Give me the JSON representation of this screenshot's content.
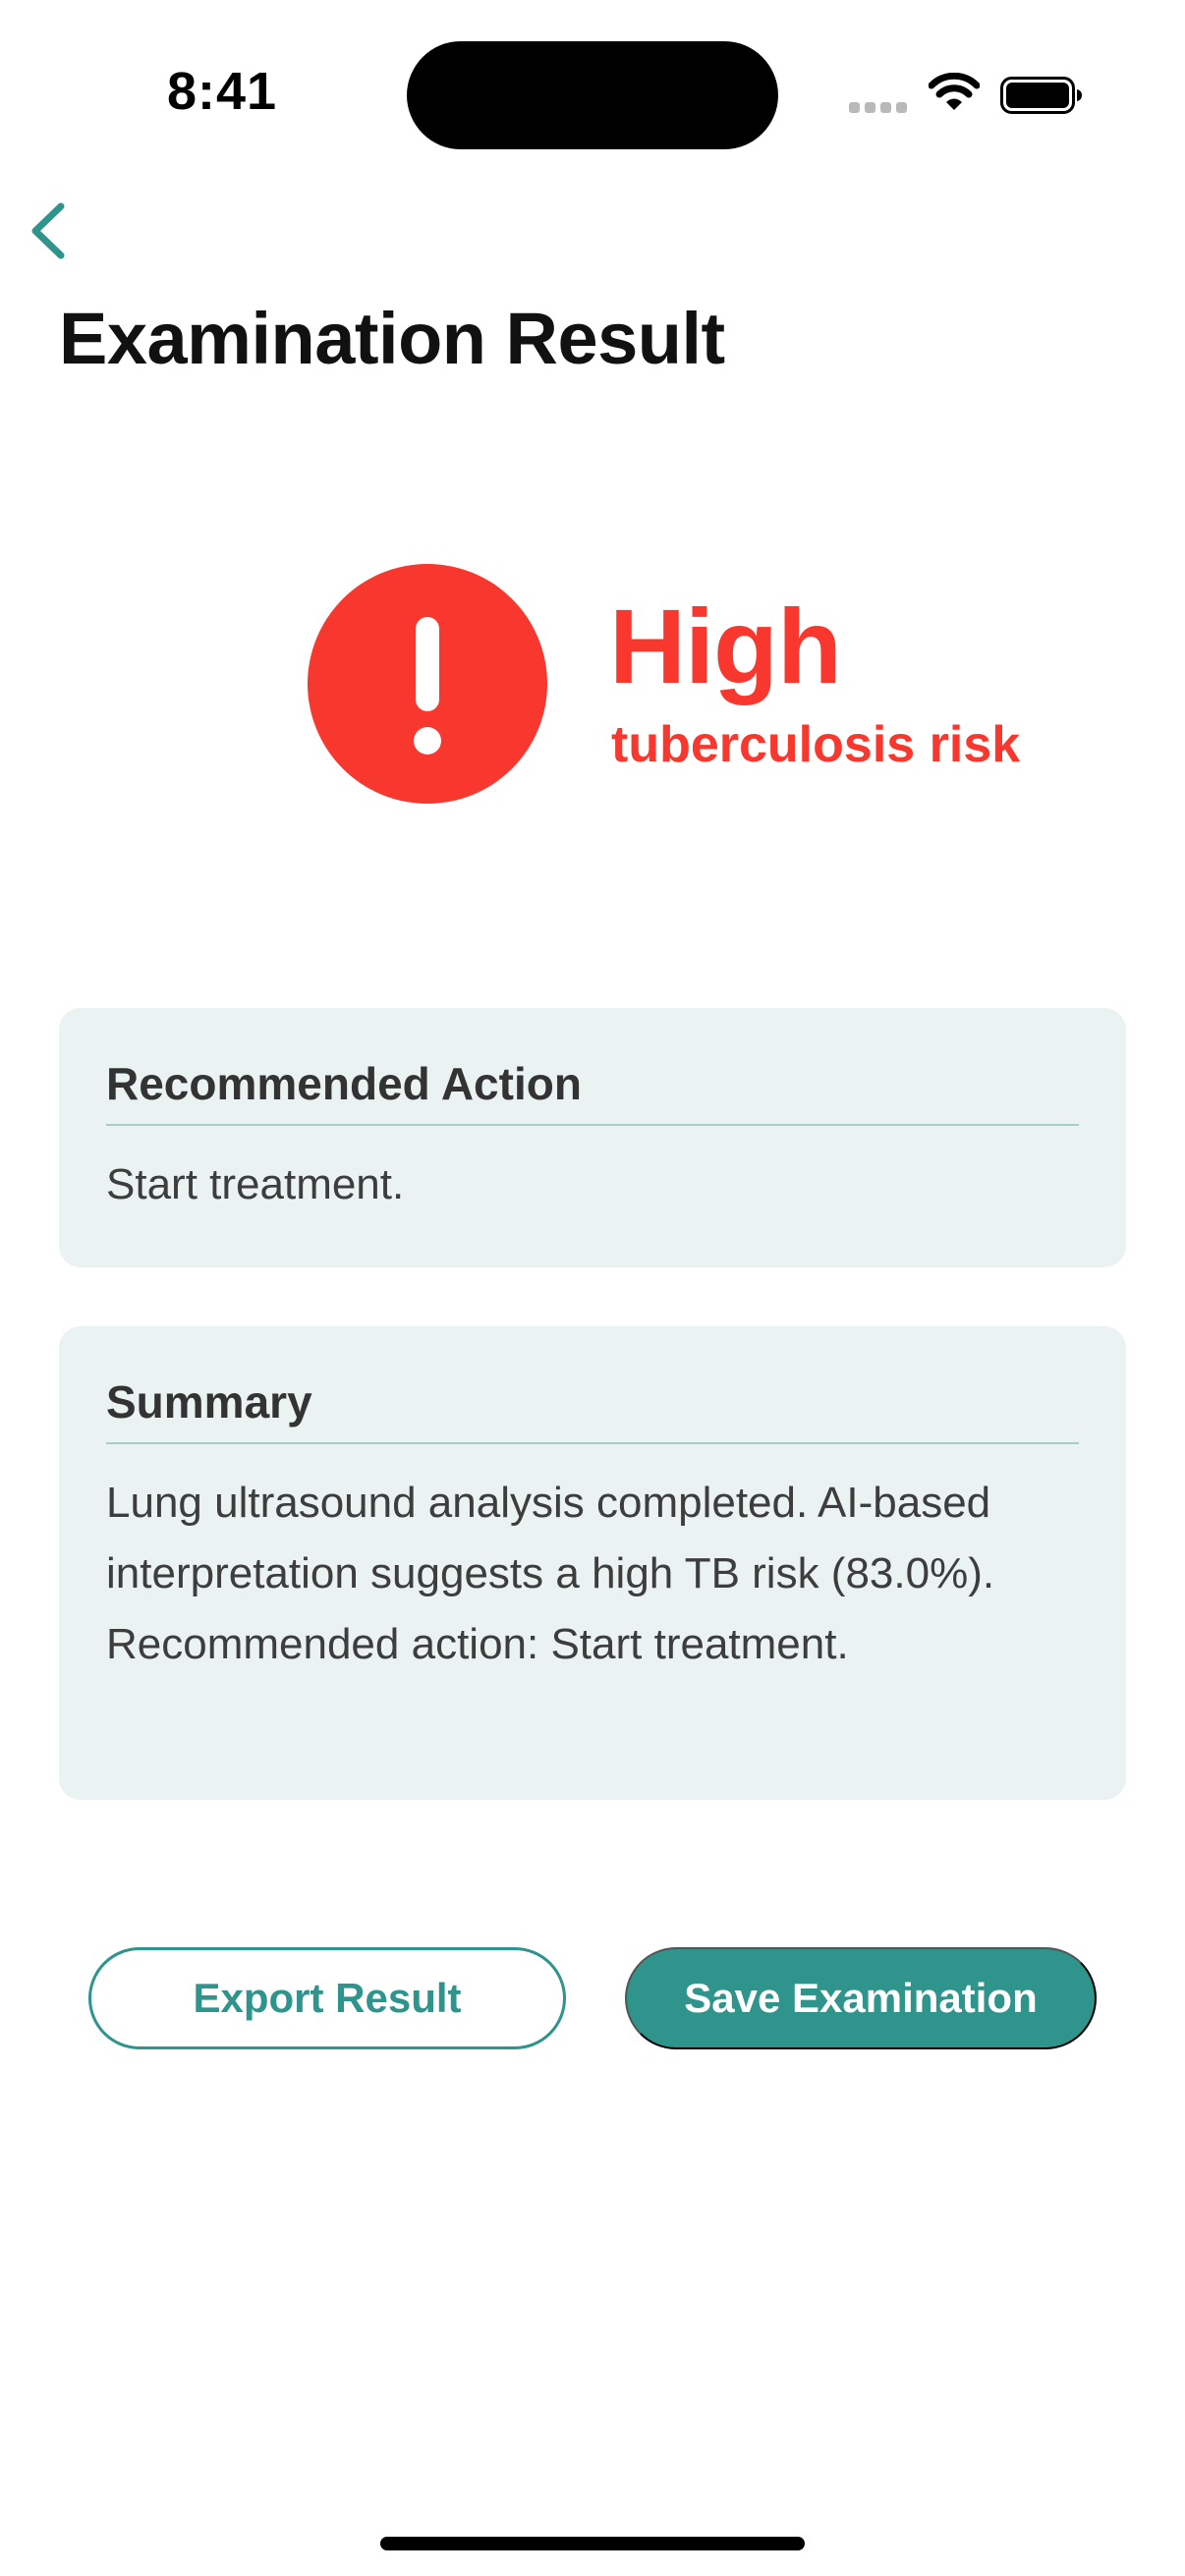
{
  "status_bar": {
    "time": "8:41"
  },
  "nav": {
    "back_icon": "chevron-left-icon",
    "title": "Examination Result"
  },
  "risk": {
    "icon": "exclamation-icon",
    "level": "High",
    "label": "tuberculosis risk",
    "color": "#f8382e"
  },
  "recommended_action": {
    "heading": "Recommended Action",
    "text": "Start treatment."
  },
  "summary": {
    "heading": "Summary",
    "text": "Lung ultrasound analysis completed. AI-based interpretation suggests a high TB risk (83.0%). Recommended action: Start treatment."
  },
  "actions": {
    "export_label": "Export Result",
    "save_label": "Save Examination"
  },
  "colors": {
    "accent": "#2e948c",
    "card_bg": "#eaf2f2",
    "danger": "#f8382e"
  }
}
